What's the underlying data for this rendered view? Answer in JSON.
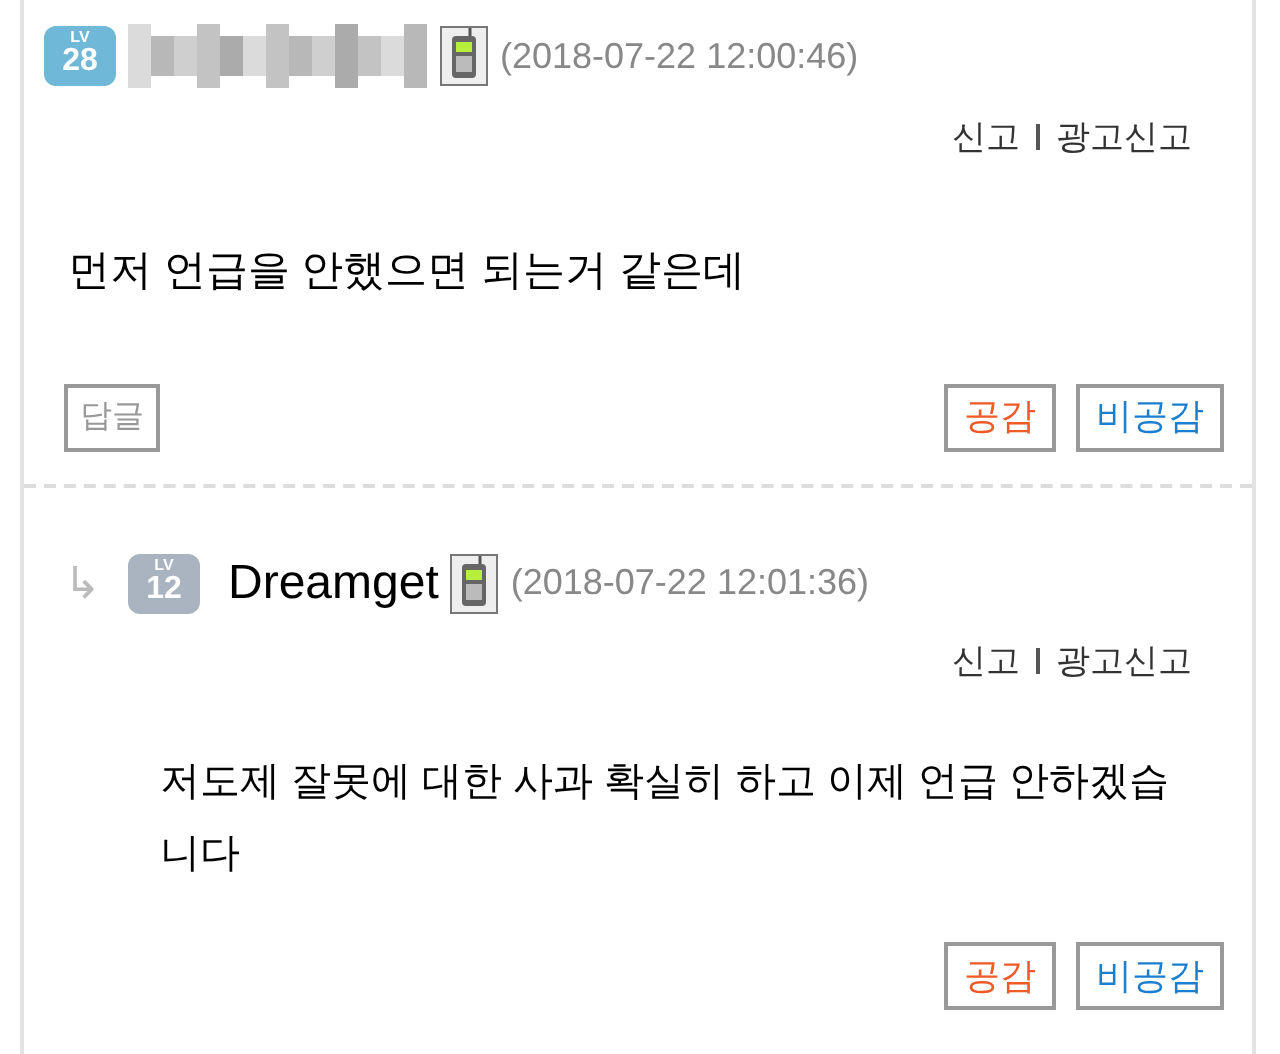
{
  "comments": [
    {
      "reply": false,
      "badge": {
        "label": "LV",
        "number": "28",
        "color": "#6fb8d8"
      },
      "mobile": true,
      "date": "(2018-07-22 12:00:46)",
      "actions": [
        "신고",
        "광고신고"
      ],
      "body": "먼저 언급을 안했으면 되는거 같은데",
      "reply_button": "답글",
      "like": "공감",
      "dislike": "비공감"
    },
    {
      "reply": true,
      "arrow": "↳",
      "badge": {
        "label": "LV",
        "number": "12",
        "color": "#a9b4c0"
      },
      "author": "Dreamget",
      "mobile": true,
      "date": "(2018-07-22 12:01:36)",
      "actions": [
        "신고",
        "광고신고"
      ],
      "body": "저도제 잘못에 대한 사과 확실히 하고 이제 언급 안하겠습니다",
      "like": "공감",
      "dislike": "비공감"
    }
  ]
}
